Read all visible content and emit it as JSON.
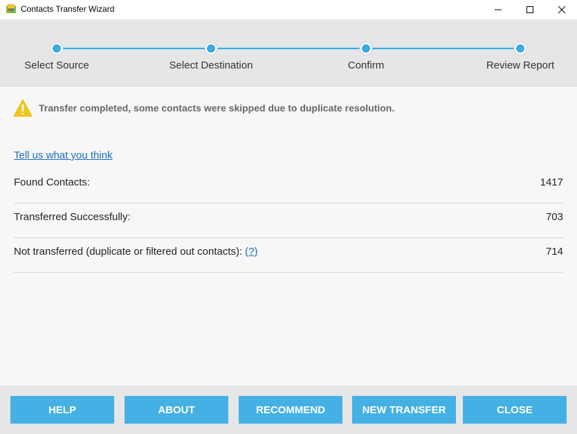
{
  "window": {
    "title": "Contacts Transfer Wizard"
  },
  "stepper": {
    "steps": [
      {
        "label": "Select Source"
      },
      {
        "label": "Select Destination"
      },
      {
        "label": "Confirm"
      },
      {
        "label": "Review Report"
      }
    ],
    "current_step": 4,
    "accent_color": "#3aaae0"
  },
  "status": {
    "icon": "warning-icon",
    "message": "Transfer completed, some contacts were skipped due to duplicate resolution.",
    "icon_color": "#f5c518"
  },
  "feedback_link": "Tell us what you think",
  "stats": [
    {
      "label": "Found Contacts:",
      "value": "1417"
    },
    {
      "label": "Transferred Successfully:",
      "value": "703"
    },
    {
      "label": "Not transferred (duplicate or filtered out contacts):",
      "value": "714",
      "help_link": "(?)"
    }
  ],
  "buttons": {
    "help": "HELP",
    "about": "ABOUT",
    "recommend": "RECOMMEND",
    "new_transfer": "NEW TRANSFER",
    "close": "CLOSE",
    "color": "#45b0e3"
  }
}
